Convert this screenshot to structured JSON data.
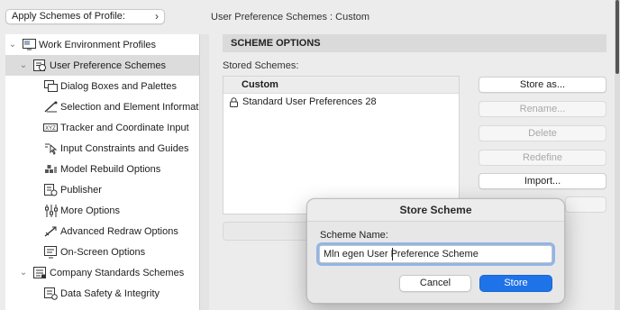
{
  "apply_schemes": {
    "label": "Apply Schemes of Profile:",
    "chevron_icon": "chevron-right-icon"
  },
  "tree": [
    {
      "label": "Work Environment Profiles",
      "icon": "profiles-icon",
      "expanded": true,
      "level": 0
    },
    {
      "label": "User Preference Schemes",
      "icon": "user-preferences-icon",
      "expanded": true,
      "level": 1,
      "selected": true
    },
    {
      "label": "Dialog Boxes and Palettes",
      "icon": "dialog-boxes-icon",
      "level": 2
    },
    {
      "label": "Selection and Element Informatic",
      "icon": "selection-info-icon",
      "level": 2
    },
    {
      "label": "Tracker and Coordinate Input",
      "icon": "tracker-xyz-icon",
      "level": 2
    },
    {
      "label": "Input Constraints and Guides",
      "icon": "input-constraints-icon",
      "level": 2
    },
    {
      "label": "Model Rebuild Options",
      "icon": "model-rebuild-icon",
      "level": 2
    },
    {
      "label": "Publisher",
      "icon": "publisher-icon",
      "level": 2
    },
    {
      "label": "More Options",
      "icon": "more-options-icon",
      "level": 2
    },
    {
      "label": "Advanced Redraw Options",
      "icon": "advanced-redraw-icon",
      "level": 2
    },
    {
      "label": "On-Screen Options",
      "icon": "on-screen-options-icon",
      "level": 2
    },
    {
      "label": "Company Standards Schemes",
      "icon": "company-standards-icon",
      "expanded": true,
      "level": 1
    },
    {
      "label": "Data Safety & Integrity",
      "icon": "data-safety-icon",
      "level": 2
    }
  ],
  "breadcrumb": "User Preference Schemes :  Custom",
  "section_title": "SCHEME OPTIONS",
  "stored_schemes_label": "Stored Schemes:",
  "schemes_list": {
    "header": "Custom",
    "rows": [
      {
        "label": "Standard User Preferences 28",
        "icon": "lock-icon"
      }
    ]
  },
  "buttons": {
    "store_as": "Store as...",
    "rename": "Rename...",
    "delete": "Delete",
    "redefine": "Redefine",
    "import": "Import..."
  },
  "dialog": {
    "title": "Store Scheme",
    "name_label": "Scheme Name:",
    "name_value": "Mln egen User Preference Scheme",
    "cancel": "Cancel",
    "store": "Store"
  },
  "colors": {
    "accent": "#1f73e8",
    "selection": "#dcdcdc",
    "focus_ring": "#2878e6"
  }
}
